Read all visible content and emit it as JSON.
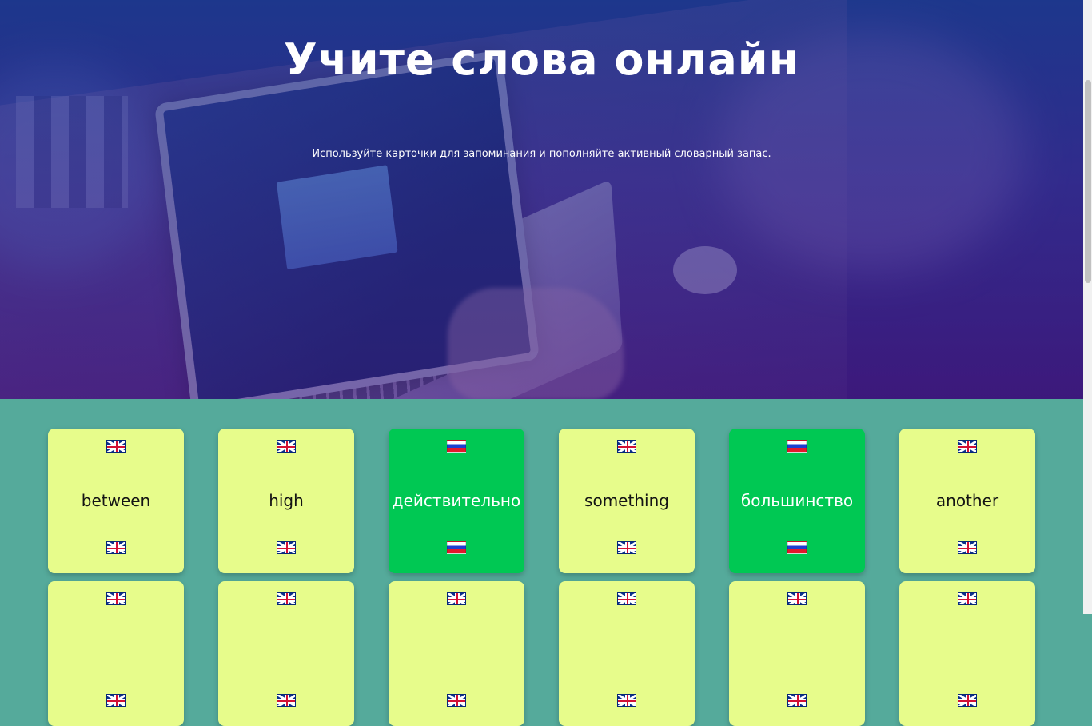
{
  "hero": {
    "title": "Учите слова онлайн",
    "subtitle": "Используйте карточки для запоминания и пополняйте активный словарный запас."
  },
  "cards": [
    {
      "word": "between",
      "lang": "en"
    },
    {
      "word": "high",
      "lang": "en"
    },
    {
      "word": "действительно",
      "lang": "ru"
    },
    {
      "word": "something",
      "lang": "en"
    },
    {
      "word": "большинство",
      "lang": "ru"
    },
    {
      "word": "another",
      "lang": "en"
    },
    {
      "word": "",
      "lang": "en"
    },
    {
      "word": "",
      "lang": "en"
    },
    {
      "word": "",
      "lang": "en"
    },
    {
      "word": "",
      "lang": "en"
    },
    {
      "word": "",
      "lang": "en"
    },
    {
      "word": "",
      "lang": "en"
    }
  ],
  "colors": {
    "en_card": "#e7fc8b",
    "ru_card": "#00c853",
    "page_background": "#55aa9b"
  },
  "icons": {
    "en": "uk-flag-icon",
    "ru": "russia-flag-icon"
  }
}
